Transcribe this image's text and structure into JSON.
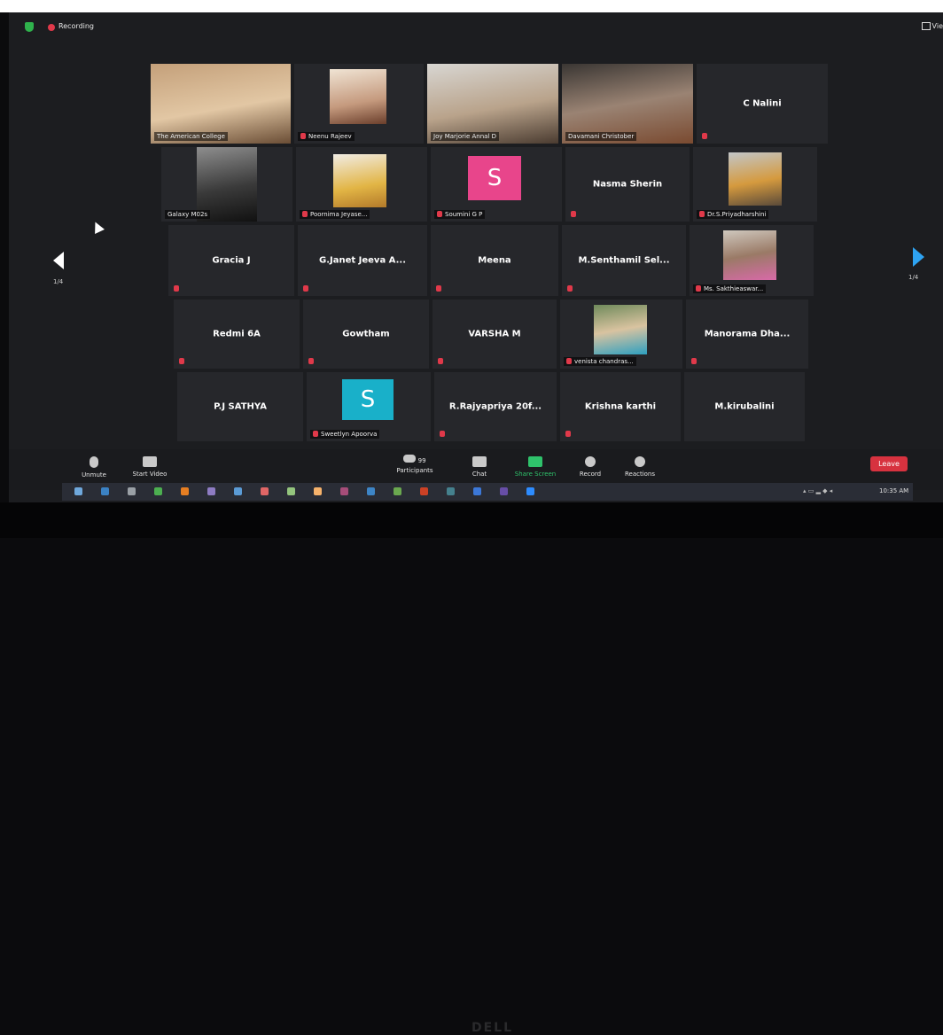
{
  "topbar": {
    "recording_label": "Recording",
    "view_label": "Vie"
  },
  "pagination": {
    "left": "1/4",
    "right": "1/4"
  },
  "participants": [
    {
      "name": "The American College",
      "type": "video"
    },
    {
      "name": "Neenu Rajeev",
      "type": "video"
    },
    {
      "name": "Joy Marjorie Annal D",
      "type": "video"
    },
    {
      "name": "Davamani Christober",
      "type": "video"
    },
    {
      "name": "C Nalini",
      "type": "name"
    },
    {
      "name": "Galaxy M02s",
      "type": "video"
    },
    {
      "name": "Poornima Jeyase...",
      "type": "video"
    },
    {
      "name": "Soumini G P",
      "type": "avatar",
      "avatar_letter": "S",
      "avatar_color": "#e8458b"
    },
    {
      "name": "Nasma Sherin",
      "type": "name"
    },
    {
      "name": "Dr.S.Priyadharshini",
      "type": "video"
    },
    {
      "name": "Gracia J",
      "type": "name"
    },
    {
      "name": "G.Janet Jeeva A...",
      "type": "name"
    },
    {
      "name": "Meena",
      "type": "name"
    },
    {
      "name": "M.Senthamil Sel...",
      "type": "name"
    },
    {
      "name": "Ms. Sakthieaswar...",
      "type": "video"
    },
    {
      "name": "Redmi 6A",
      "type": "name"
    },
    {
      "name": "Gowtham",
      "type": "name"
    },
    {
      "name": "VARSHA M",
      "type": "name"
    },
    {
      "name": "venista chandras...",
      "type": "video"
    },
    {
      "name": "Manorama Dha...",
      "type": "name"
    },
    {
      "name": "P.J SATHYA",
      "type": "name"
    },
    {
      "name": "Sweetlyn Apoorva",
      "type": "avatar",
      "avatar_letter": "S",
      "avatar_color": "#19b0c9"
    },
    {
      "name": "R.Rajyapriya 20f...",
      "type": "name"
    },
    {
      "name": "Krishna karthi",
      "type": "name"
    },
    {
      "name": "M.kirubalini",
      "type": "name"
    }
  ],
  "toolbar": {
    "unmute": "Unmute",
    "start_video": "Start Video",
    "participants": "Participants",
    "participant_count": "99",
    "chat": "Chat",
    "share_screen": "Share Screen",
    "record": "Record",
    "reactions": "Reactions",
    "leave": "Leave"
  },
  "taskbar": {
    "clock": "10:35 AM"
  },
  "monitor": {
    "brand": "DELL"
  },
  "colors": {
    "active_speaker": "#c8d84a",
    "leave": "#d7323f",
    "share_screen": "#2fc26b",
    "nav_arrow": "#2ea3f2"
  }
}
